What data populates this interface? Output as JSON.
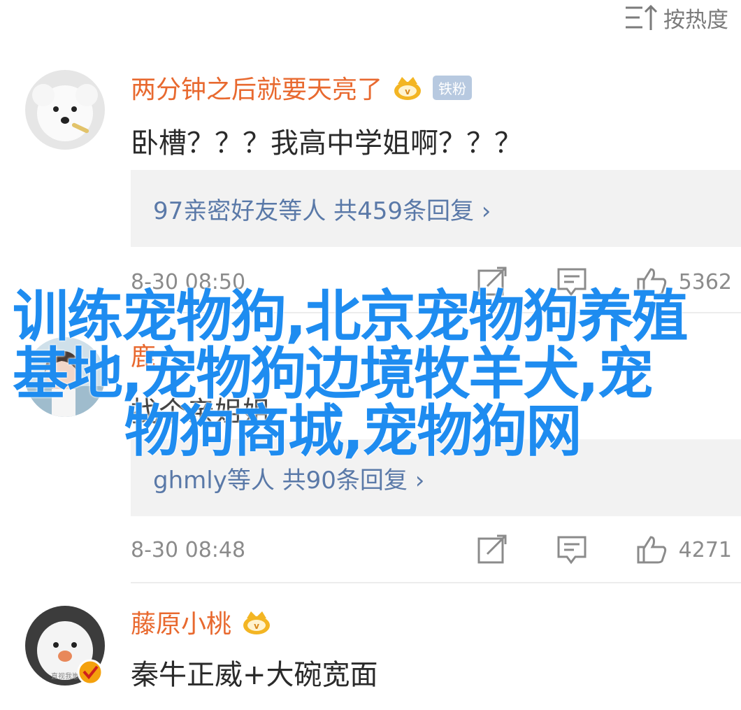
{
  "sort": {
    "label": "按热度"
  },
  "comments": [
    {
      "username": "两分钟之后就要天亮了",
      "badge": "铁粉",
      "text": "卧槽？？？我高中学姐啊？？？",
      "reply_summary": "97亲密好友等人 共459条回复 ›",
      "timestamp": "8-30 08:50",
      "likes": "5362"
    },
    {
      "username": "鹿",
      "badge": "",
      "text": "找个亲姐姐",
      "reply_summary": "ghmly等人 共90条回复 ›",
      "timestamp": "8-30 08:48",
      "likes": "4271"
    },
    {
      "username": "藤原小桃",
      "text": "秦牛正威+大碗宽面",
      "avatar_caption": "直视我崽"
    }
  ],
  "overlay": {
    "line1": "训练宠物狗,北京宠物狗养殖",
    "line2": "基地,宠物狗边境牧羊犬,宠",
    "line3": "物狗商城,宠物狗网"
  },
  "colors": {
    "username": "#e8692f",
    "reply_link": "#5a79a8",
    "overlay_text": "#1e8cf0",
    "badge_bg": "#b7c9e0"
  }
}
